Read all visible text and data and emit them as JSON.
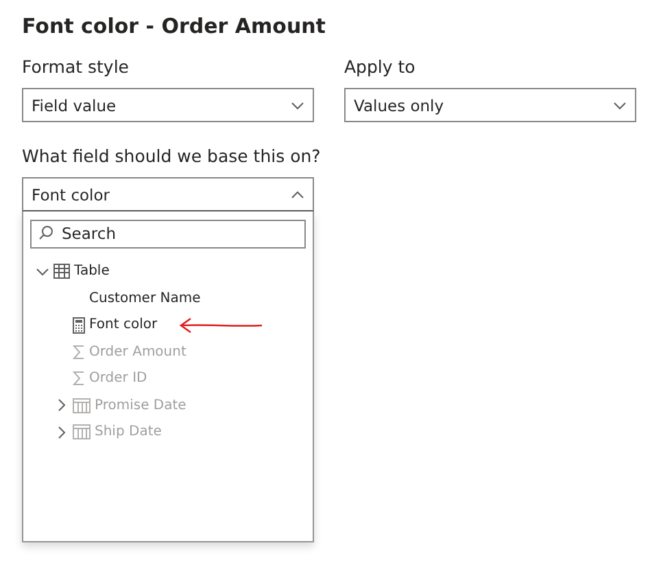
{
  "title": "Font color - Order Amount",
  "fields": [
    {
      "label": "Format style",
      "value": "Field value",
      "expanded": false
    },
    {
      "label": "Apply to",
      "value": "Values only",
      "expanded": false
    }
  ],
  "base_field": {
    "label": "What field should we base this on?",
    "value": "Font color",
    "expanded": true
  },
  "search": {
    "placeholder": "Search"
  },
  "tree": [
    {
      "label": "Table",
      "kind": "table",
      "expanded": true,
      "disabled": false,
      "children": [
        {
          "label": "Customer Name",
          "kind": "text",
          "disabled": false
        },
        {
          "label": "Font color",
          "kind": "measure",
          "disabled": false,
          "annotated": true
        },
        {
          "label": "Order Amount",
          "kind": "sum",
          "disabled": true
        },
        {
          "label": "Order ID",
          "kind": "sum",
          "disabled": true
        },
        {
          "label": "Promise Date",
          "kind": "date",
          "disabled": true,
          "expanded": false
        },
        {
          "label": "Ship Date",
          "kind": "date",
          "disabled": true,
          "expanded": false
        }
      ]
    }
  ]
}
